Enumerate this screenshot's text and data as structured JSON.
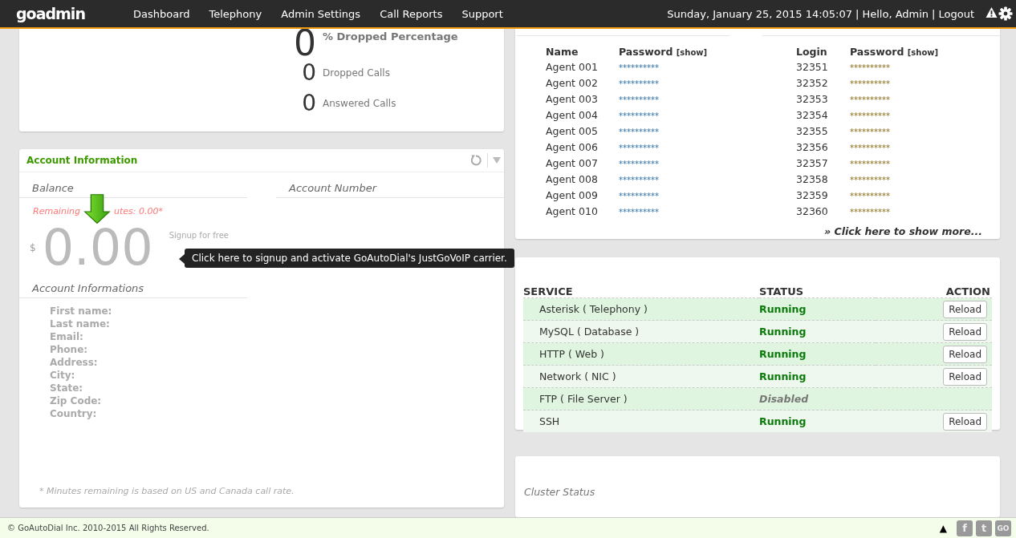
{
  "nav": {
    "logo": "goadmin",
    "items": [
      "Dashboard",
      "Telephony",
      "Admin Settings",
      "Call Reports",
      "Support"
    ],
    "datetime": "Sunday, January 25, 2015 14:05:07",
    "separator": "|",
    "greeting": "Hello, Admin",
    "logout": "Logout"
  },
  "call_stats": [
    {
      "kind": "headline",
      "value": "0",
      "label": "% Dropped Percentage"
    },
    {
      "kind": "normal",
      "value": "0",
      "label": "Dropped Calls"
    },
    {
      "kind": "normal",
      "value": "0",
      "label": "Answered Calls"
    }
  ],
  "account": {
    "title": "Account Information",
    "balance_heading": "Balance",
    "account_number_heading": "Account Number",
    "remaining_before": "Remaining",
    "remaining_after": "utes: 0.00*",
    "currency": "$",
    "balance": "0.00",
    "signup": "Signup for free",
    "tooltip": "Click here to signup and activate GoAutoDial's JustGoVoIP carrier.",
    "info_heading": "Account Informations",
    "fields": [
      "First name:",
      "Last name:",
      "Email:",
      "Phone:",
      "Address:",
      "City:",
      "State:",
      "Zip Code:",
      "Country:"
    ],
    "footnote": "* Minutes remaining is based on US and Canada call rate."
  },
  "agents": {
    "columns": [
      "Name",
      "Password",
      "Login",
      "Password"
    ],
    "show_link": "[show]",
    "login_show_link": "[show]",
    "rows": [
      {
        "name": "Agent 001",
        "password": "**********",
        "login": "32351",
        "login_password": "**********"
      },
      {
        "name": "Agent 002",
        "password": "**********",
        "login": "32352",
        "login_password": "**********"
      },
      {
        "name": "Agent 003",
        "password": "**********",
        "login": "32353",
        "login_password": "**********"
      },
      {
        "name": "Agent 004",
        "password": "**********",
        "login": "32354",
        "login_password": "**********"
      },
      {
        "name": "Agent 005",
        "password": "**********",
        "login": "32355",
        "login_password": "**********"
      },
      {
        "name": "Agent 006",
        "password": "**********",
        "login": "32356",
        "login_password": "**********"
      },
      {
        "name": "Agent 007",
        "password": "**********",
        "login": "32357",
        "login_password": "**********"
      },
      {
        "name": "Agent 008",
        "password": "**********",
        "login": "32358",
        "login_password": "**********"
      },
      {
        "name": "Agent 009",
        "password": "**********",
        "login": "32359",
        "login_password": "**********"
      },
      {
        "name": "Agent 010",
        "password": "**********",
        "login": "32360",
        "login_password": "**********"
      }
    ],
    "more": "» Click here to show more..."
  },
  "services": {
    "columns": [
      "SERVICE",
      "STATUS",
      "ACTION"
    ],
    "rows": [
      {
        "service": "Asterisk ( Telephony )",
        "status": "Running",
        "disabled": false,
        "action": "Reload"
      },
      {
        "service": "MySQL ( Database )",
        "status": "Running",
        "disabled": false,
        "action": "Reload"
      },
      {
        "service": "HTTP ( Web )",
        "status": "Running",
        "disabled": false,
        "action": "Reload"
      },
      {
        "service": "Network ( NIC )",
        "status": "Running",
        "disabled": false,
        "action": "Reload"
      },
      {
        "service": "FTP ( File Server )",
        "status": "Disabled",
        "disabled": true
      },
      {
        "service": "SSH",
        "status": "Running",
        "disabled": false,
        "action": "Reload"
      }
    ]
  },
  "cluster": {
    "title": "Cluster Status"
  },
  "footer": {
    "copyright": "© GoAutoDial Inc. 2010-2015 All Rights Reserved.",
    "up": "▲",
    "social": [
      "f",
      "t",
      "GO"
    ]
  }
}
